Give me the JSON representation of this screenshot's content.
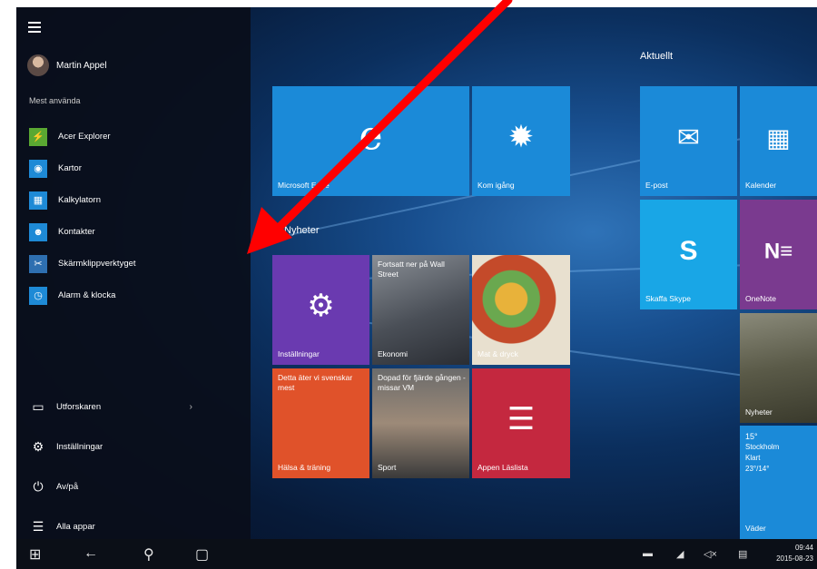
{
  "user": {
    "name": "Martin Appel"
  },
  "start_menu": {
    "section_label": "Mest använda",
    "apps": [
      {
        "label": "Acer Explorer",
        "icon": "acer-explorer-icon",
        "color": "#5aa832",
        "glyph": "⚡"
      },
      {
        "label": "Kartor",
        "icon": "maps-icon",
        "color": "#1e8ad6",
        "glyph": "◉"
      },
      {
        "label": "Kalkylatorn",
        "icon": "calculator-icon",
        "color": "#1e8ad6",
        "glyph": "▦"
      },
      {
        "label": "Kontakter",
        "icon": "contacts-icon",
        "color": "#1e8ad6",
        "glyph": "👥"
      },
      {
        "label": "Skärmklippverktyget",
        "icon": "snipping-tool-icon",
        "color": "#2e6fb0",
        "glyph": "✂"
      },
      {
        "label": "Alarm & klocka",
        "icon": "alarm-clock-icon",
        "color": "#1e8ad6",
        "glyph": "⏰"
      }
    ],
    "explorer_label": "Utforskaren",
    "settings_label": "Inställningar",
    "power_label": "Av/på",
    "all_apps_label": "Alla appar"
  },
  "groups": {
    "current": "Aktuellt",
    "news": "Nyheter"
  },
  "tiles": {
    "edge": "Microsoft Edge",
    "get_started": "Kom igång",
    "mail": "E-post",
    "calendar": "Kalender",
    "skype": "Skaffa Skype",
    "onenote": "OneNote",
    "settings": "Inställningar",
    "finance": "Ekonomi",
    "finance_headline": "Fortsatt ner på Wall Street",
    "food": "Mat & dryck",
    "health": "Hälsa & träning",
    "health_headline": "Detta äter vi svenskar mest",
    "sport": "Sport",
    "sport_headline": "Dopad för fjärde gången - missar VM",
    "reading_list": "Appen Läslista",
    "news": "Nyheter",
    "weather_temp": "15°",
    "weather_city": "Stockholm",
    "weather_condition": "Klart",
    "weather_range": "23°/14°",
    "weather": "Väder"
  },
  "clock": {
    "time": "09:44",
    "date": "2015-08-23"
  },
  "colors": {
    "accent": "#1e8ad6",
    "tile_blue": "#1b8ad8",
    "tile_purple": "#6a3ab0",
    "tile_red": "#c4283f",
    "tile_orange": "#e0522a",
    "onenote": "#7a3a8f",
    "arrow": "#ff0000"
  }
}
